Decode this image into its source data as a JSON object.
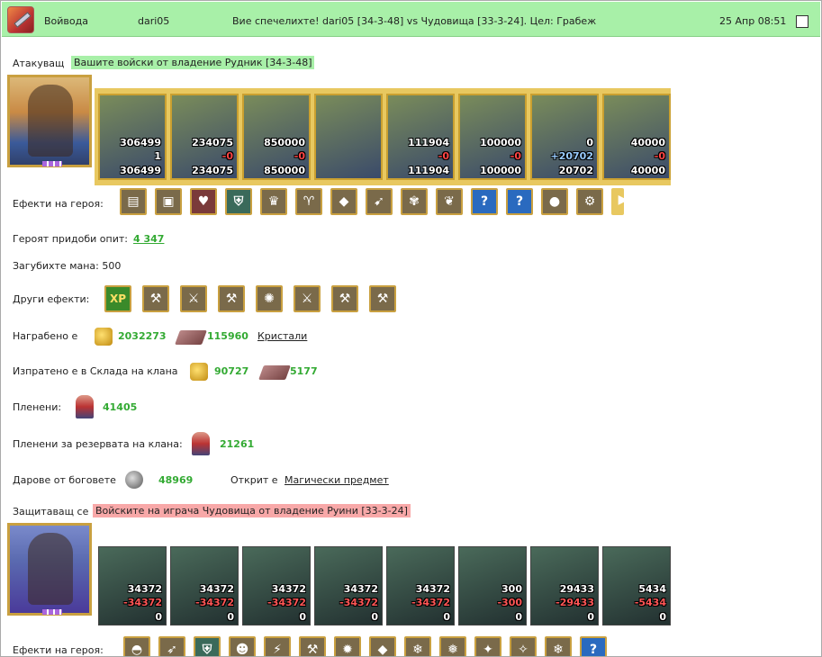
{
  "header": {
    "role": "Войвода",
    "user": "dari05",
    "message": "Вие спечелихте! dari05 [34-3-48] vs Чудовища [33-3-24]. Цел: Грабеж",
    "datetime": "25 Апр 08:51",
    "logo_icon": "battle-axe-icon"
  },
  "attacker": {
    "label": "Атакуващ",
    "tag": "Вашите войски от владение Рудник [34-3-48]",
    "units": [
      {
        "top": "306499",
        "mid": "1",
        "mid_color": "white",
        "bottom": "306499"
      },
      {
        "top": "234075",
        "mid": "-0",
        "mid_color": "red",
        "bottom": "234075"
      },
      {
        "top": "850000",
        "mid": "-0",
        "mid_color": "red",
        "bottom": "850000"
      },
      {
        "top": "",
        "mid": "",
        "mid_color": "red",
        "bottom": ""
      },
      {
        "top": "111904",
        "mid": "-0",
        "mid_color": "red",
        "bottom": "111904"
      },
      {
        "top": "100000",
        "mid": "-0",
        "mid_color": "red",
        "bottom": "100000"
      },
      {
        "top": "0",
        "mid": "+20702",
        "mid_color": "blue",
        "bottom": "20702"
      },
      {
        "top": "40000",
        "mid": "-0",
        "mid_color": "red",
        "bottom": "40000"
      }
    ],
    "effects_label": "Ефекти на героя:",
    "effects_icons": [
      "book-icon",
      "chest-icon",
      "heart-icon",
      "shield-icon",
      "crown-icon",
      "ram-icon",
      "gem-icon",
      "crossbow-icon",
      "tree-icon",
      "leaf-icon",
      "question-icon",
      "question-icon",
      "amulet-icon",
      "gear-icon",
      "arrow-right-icon"
    ],
    "experience_label": "Героят придоби опит:",
    "experience_value": "4 347",
    "mana_label": "Загубихте мана: 500",
    "other_effects_label": "Други ефекти:",
    "other_effects_icons": [
      "xp-icon",
      "axe-icon",
      "sword-icon",
      "axe-icon",
      "rune-icon",
      "sword-icon",
      "axe-icon",
      "axe-icon"
    ],
    "other_effects_xp": "XP",
    "looted_label": "Награбено е",
    "looted_gold": "2032273",
    "looted_crystals": "115960",
    "crystals_link": "Кристали",
    "spent_label": "Изпратено е в Склада на клана",
    "spent_gold": "90727",
    "spent_crystals": "5177",
    "captured_label": "Пленени:",
    "captured_value": "41405",
    "reserve_label": "Пленени за резервата на клана:",
    "reserve_value": "21261",
    "gods_label": "Дарове от боговете",
    "gods_value": "48969",
    "found_label": "Открит е",
    "found_link": "Магически предмет"
  },
  "defender": {
    "label": "Защитаващ се",
    "tag": "Войските на играча Чудовища от владение Руини [33-3-24]",
    "units": [
      {
        "top": "34372",
        "mid": "-34372",
        "bottom": "0"
      },
      {
        "top": "34372",
        "mid": "-34372",
        "bottom": "0"
      },
      {
        "top": "34372",
        "mid": "-34372",
        "bottom": "0"
      },
      {
        "top": "34372",
        "mid": "-34372",
        "bottom": "0"
      },
      {
        "top": "34372",
        "mid": "-34372",
        "bottom": "0"
      },
      {
        "top": "300",
        "mid": "-300",
        "bottom": "0"
      },
      {
        "top": "29433",
        "mid": "-29433",
        "bottom": "0"
      },
      {
        "top": "5434",
        "mid": "-5434",
        "bottom": "0"
      }
    ],
    "effects_label": "Ефекти на героя:",
    "effects_icons": [
      "helmet-icon",
      "arrows-icon",
      "shield-icon",
      "dwarf-icon",
      "bolt-icon",
      "hammer-icon",
      "fire-icon",
      "crystal-icon",
      "ice-icon",
      "ice-swirl-icon",
      "wand-icon",
      "staff-icon",
      "frost-icon",
      "question-icon"
    ]
  }
}
